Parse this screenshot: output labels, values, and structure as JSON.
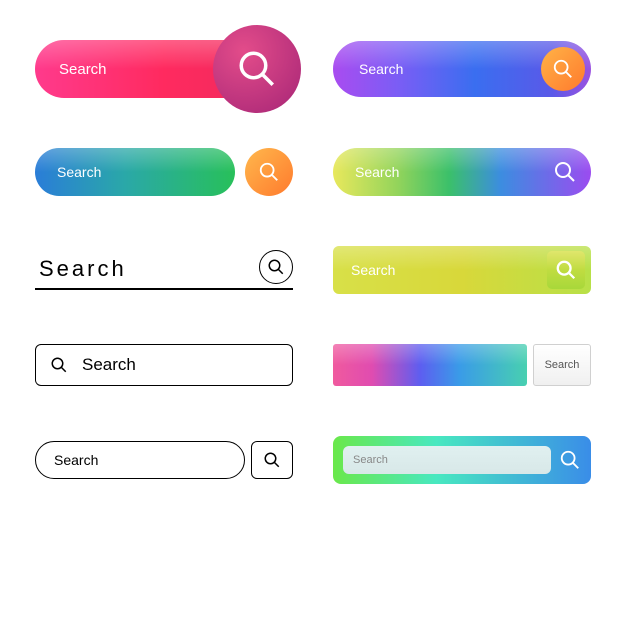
{
  "bars": {
    "s1": {
      "label": "Search"
    },
    "s2": {
      "label": "Search"
    },
    "s3": {
      "label": "Search"
    },
    "s4": {
      "label": "Search"
    },
    "s5": {
      "label": "Search"
    },
    "s6": {
      "label": "Search"
    },
    "s7": {
      "label": "Search"
    },
    "s8": {
      "button_label": "Search"
    },
    "s9": {
      "label": "Search"
    },
    "s10": {
      "placeholder": "Search"
    }
  }
}
